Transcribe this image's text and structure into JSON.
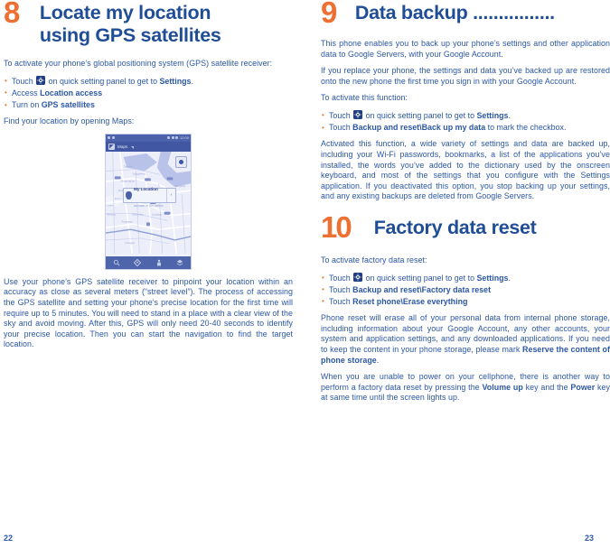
{
  "theme": {
    "accent_orange": "#ED6F31",
    "heading_blue": "#1F4D96",
    "body_blue": "#2B57A4"
  },
  "left_page": {
    "page_number": "22",
    "section": {
      "number": "8",
      "title_line1": "Locate my location",
      "title_line2": "using GPS satellites"
    },
    "intro": "To activate your phone’s global positioning system (GPS) satellite receiver:",
    "bullets": [
      {
        "pre": "Touch ",
        "icon": "gear-icon",
        "mid": " on quick setting panel to get to ",
        "bold": "Settings",
        "post": "."
      },
      {
        "pre": "Access ",
        "bold": "Location access",
        "post": ""
      },
      {
        "pre": "Turn on ",
        "bold": "GPS satellites",
        "post": ""
      }
    ],
    "find_line": "Find your location by opening Maps:",
    "screenshot": {
      "status_time": "12:00",
      "app_label": "Maps",
      "callout_title": "My Location",
      "callout_sub": "accurate to 100 meters",
      "toolbar_icons": [
        "search-icon",
        "directions-icon",
        "navigation-icon",
        "layers-icon"
      ]
    },
    "closing": "Use your phone’s GPS satellite receiver to pinpoint your location within an accuracy as close as several meters (“street level”). The process of accessing the GPS satellite and setting your phone's precise location for the first time will require up to 5 minutes. You will need to stand in a place with a clear view of the sky and avoid moving. After this, GPS will only need 20-40 seconds to identify your precise location. Then you can start the navigation to find the target location."
  },
  "right_page": {
    "page_number": "23",
    "section9": {
      "number": "9",
      "title": "Data backup ................",
      "para1": "This phone enables you to back up your phone’s settings and other application data to Google Servers, with your Google Account.",
      "para2": "If you replace your phone, the settings and data you’ve backed up are restored onto the new phone the first time you sign in with your Google Account.",
      "activate_line": "To activate this function:",
      "bullets": [
        {
          "pre": "Touch ",
          "icon": "gear-icon",
          "mid": " on quick setting panel to get to ",
          "bold": "Settings",
          "post": "."
        },
        {
          "pre": "Touch ",
          "bold": "Backup and reset\\Back up my data",
          "post": " to mark the checkbox."
        }
      ],
      "para3": "Activated this function, a wide variety of settings and data are backed up, including your Wi-Fi passwords, bookmarks, a list of the applications you’ve installed, the words you’ve added to the dictionary used by the onscreen keyboard, and most of the settings that you configure with the Settings application. If you deactivated this option, you stop backing up your settings, and any existing backups are deleted from Google Servers."
    },
    "section10": {
      "number": "10",
      "title": "Factory data reset",
      "activate_line": "To activate factory data reset:",
      "bullets": [
        {
          "pre": "Touch ",
          "icon": "gear-icon",
          "mid": " on quick setting panel to get to ",
          "bold": "Settings",
          "post": "."
        },
        {
          "pre": "Touch ",
          "bold": "Backup and reset\\Factory data reset",
          "post": ""
        },
        {
          "pre": "Touch ",
          "bold": "Reset phone\\Erase everything",
          "post": ""
        }
      ],
      "para1_a": "Phone reset will erase all of your personal data from internal phone storage, including information about your Google Account, any other accounts, your system and application settings, and any downloaded applications. If you need to keep the content in your phone storage, please mark ",
      "para1_bold": "Reserve the content of phone storage",
      "para1_b": ".",
      "para2_a": "When you are unable to power on your cellphone, there is another way to perform a factory data reset by pressing the ",
      "para2_bold1": "Volume up",
      "para2_mid": " key and the ",
      "para2_bold2": "Power",
      "para2_b": " key at same time until the screen lights up."
    }
  }
}
